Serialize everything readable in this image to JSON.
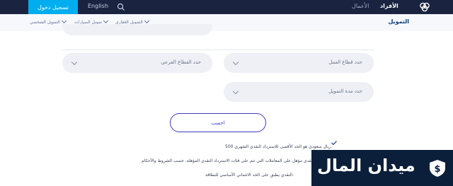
{
  "topbar": {
    "login_label": "تسجيل دخول",
    "language_label": "English",
    "links": [
      "الأعمال",
      "الأفراد"
    ]
  },
  "subnav": {
    "title": "التمويل",
    "items": [
      "التمويل العقاري",
      "تمويل السيارات",
      "التمويل الشخصي"
    ]
  },
  "form": {
    "sector_placeholder": "حدد قطاع العمل",
    "subsector_placeholder": "حدد القطاع الفرعي",
    "term_placeholder": "حدد مدة التمويل",
    "calculate_label": "احسب"
  },
  "notes": [
    "500 ريال سعودي هو الحد الأقصى للاسترداد النقدي الشهري.",
    "النقدي مؤهل على المعاملات التي تتم على فئات الاسترداد النقدي المؤهلة. حسب الشروط والأحكام",
    "النقدي يطبق على الحد الائتماني الأساسي للبطاقة."
  ],
  "watermark": {
    "text": "ميدان المال"
  },
  "colors": {
    "topbar": "#1a2440",
    "accent": "#00aeef",
    "button_border": "#3c3cbf",
    "watermark_bg": "#0b1f3a"
  }
}
